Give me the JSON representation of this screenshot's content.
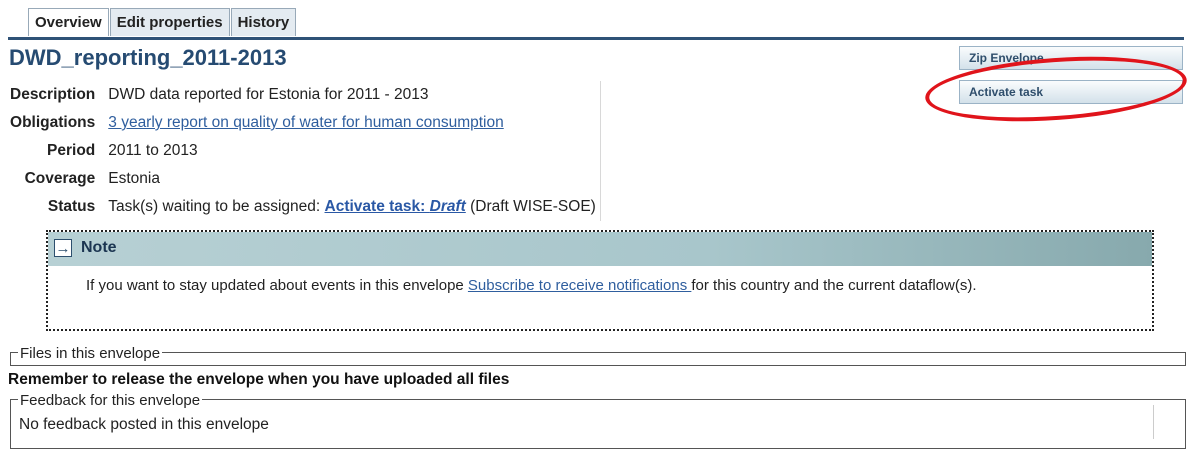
{
  "tabs": [
    {
      "label": "Overview",
      "active": true
    },
    {
      "label": "Edit properties",
      "active": false
    },
    {
      "label": "History",
      "active": false
    }
  ],
  "page_title": "DWD_reporting_2011-2013",
  "side_buttons": {
    "zip": "Zip Envelope",
    "activate": "Activate task"
  },
  "properties": {
    "description": {
      "label": "Description",
      "value": "DWD data reported for Estonia for 2011 - 2013"
    },
    "obligations": {
      "label": "Obligations",
      "value": "3 yearly report on quality of water for human consumption"
    },
    "period": {
      "label": "Period",
      "value": "2011 to 2013"
    },
    "coverage": {
      "label": "Coverage",
      "value": "Estonia"
    },
    "status": {
      "label": "Status",
      "prefix": "Task(s) waiting to be assigned: ",
      "link_text": "Activate task: ",
      "link_emphasis": "Draft",
      "suffix": " (Draft WISE-SOE)"
    }
  },
  "note": {
    "title": "Note",
    "text_before": "If you want to stay updated about events in this envelope ",
    "link": "Subscribe to receive notifications ",
    "text_after": "for this country and the current dataflow(s)."
  },
  "files_legend": "Files in this envelope",
  "remember_text": "Remember to release the envelope when you have uploaded all files",
  "feedback": {
    "legend": "Feedback for this envelope",
    "empty_text": "No feedback posted in this envelope"
  },
  "colors": {
    "accent": "#264b72",
    "highlight_ring": "#e0141b",
    "link": "#2f5e9e"
  }
}
